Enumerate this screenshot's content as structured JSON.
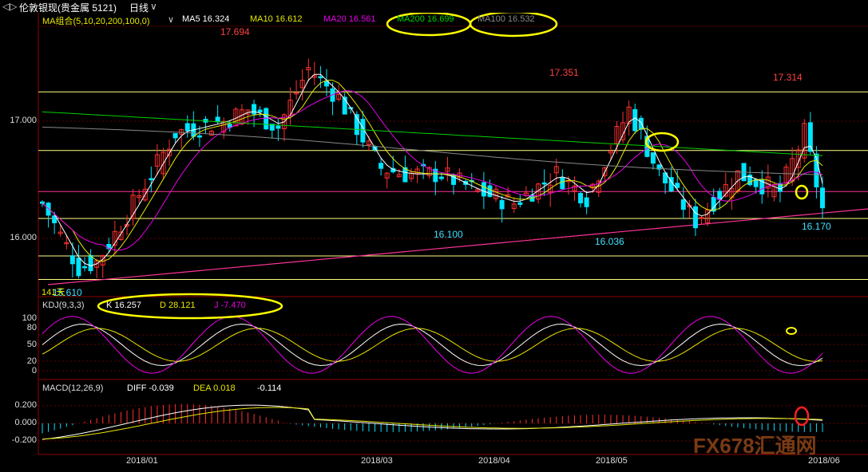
{
  "title_bar": {
    "back_icon": "back-arrow-icon",
    "instrument": "伦敦银现(贵金属 5121)",
    "period": "日线",
    "period_dropdown_icon": "chevron-down-icon"
  },
  "ma_legend": {
    "group_label": "MA组合(5,10,20,200,100,0)",
    "ma5": "MA5 16.324",
    "ma10": "MA10 16.612",
    "ma20": "MA20 16.561",
    "ma200": "MA200 16.699",
    "ma100": "MA100 16.532",
    "colors": {
      "group": "#e8e800",
      "ma5": "#ffffff",
      "ma10": "#e8e800",
      "ma20": "#e800e8",
      "ma200": "#00d000",
      "ma100": "#888888"
    }
  },
  "price_axis": {
    "ticks": [
      "17.000",
      "16.000"
    ]
  },
  "kdj_legend": {
    "label": "KDJ(9,3,3)",
    "k": "K 16.257",
    "d": "D 28.121",
    "j": "J -7.470"
  },
  "kdj_axis": {
    "ticks": [
      "100",
      "80",
      "50",
      "20",
      "0"
    ]
  },
  "macd_legend": {
    "label": "MACD(12,26,9)",
    "diff": "DIFF -0.039",
    "dea": "DEA 0.018",
    "macd": "-0.114"
  },
  "macd_axis": {
    "ticks": [
      "0.200",
      "0.000",
      "-0.200"
    ]
  },
  "x_axis": {
    "ticks": [
      "2018/01",
      "2018/03",
      "2018/04",
      "2018/05",
      "2018/06"
    ]
  },
  "annotations": {
    "high1": "17.694",
    "high2": "17.351",
    "high3": "17.314",
    "low1": "16.100",
    "low2": "16.036",
    "low3": "16.170",
    "low0": "15.610",
    "left_mark": "141天"
  },
  "watermark": {
    "latin": "FX678",
    "cn": "汇通网"
  },
  "colors": {
    "up": "#ff3030",
    "down": "#00e5ff",
    "yellow_line": "#ffff80",
    "pink_line": "#ff3399",
    "highlight": "#ffff00",
    "alert": "#ff2020"
  },
  "chart_data": {
    "type": "candlestick",
    "title": "",
    "xlabel": "",
    "ylabel": "",
    "ylim": [
      15.55,
      17.85
    ],
    "x": [
      "2018/01",
      "2018/03",
      "2018/04",
      "2018/05",
      "2018/06"
    ],
    "series": [
      {
        "name": "MA5",
        "values": [
          16.324
        ]
      },
      {
        "name": "MA10",
        "values": [
          16.612
        ]
      },
      {
        "name": "MA20",
        "values": [
          16.561
        ]
      },
      {
        "name": "MA200",
        "values": [
          16.699
        ]
      },
      {
        "name": "MA100",
        "values": [
          16.532
        ]
      },
      {
        "name": "K",
        "values": [
          16.257
        ]
      },
      {
        "name": "D",
        "values": [
          28.121
        ]
      },
      {
        "name": "J",
        "values": [
          -7.47
        ]
      },
      {
        "name": "DIFF",
        "values": [
          -0.039
        ]
      },
      {
        "name": "DEA",
        "values": [
          0.018
        ]
      },
      {
        "name": "MACD",
        "values": [
          -0.114
        ]
      }
    ],
    "marked_prices": [
      17.694,
      17.351,
      17.314,
      16.1,
      16.036,
      16.17,
      15.61
    ],
    "horizontal_levels": [
      17.25,
      16.75,
      16.4,
      16.17,
      15.85,
      15.65
    ],
    "grid": true,
    "legend": "top-left"
  }
}
